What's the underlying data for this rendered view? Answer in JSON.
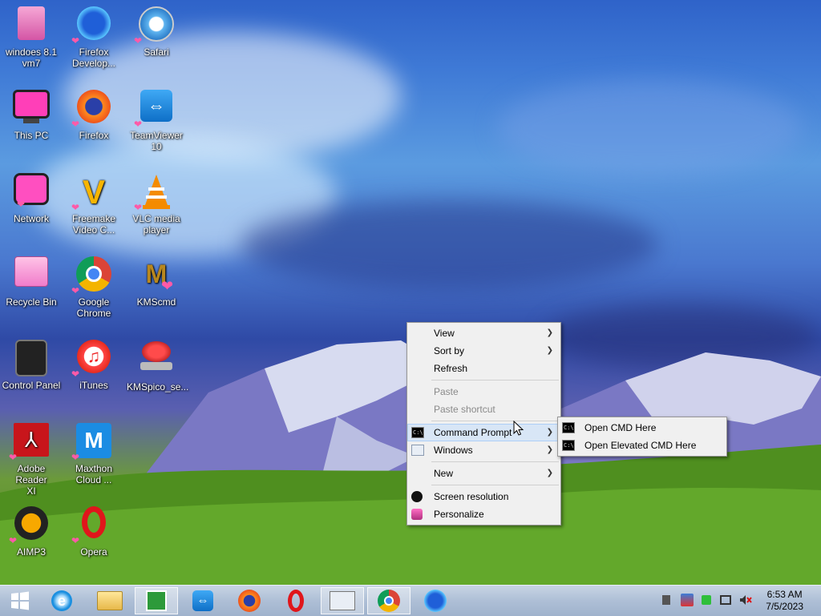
{
  "desktop_icons": [
    {
      "label": "windoes 8.1\nvm7",
      "icon": "user-folder-icon"
    },
    {
      "label": "Firefox\nDevelop...",
      "icon": "firefox-developer-icon"
    },
    {
      "label": "Safari",
      "icon": "safari-icon"
    },
    {
      "label": "This PC",
      "icon": "this-pc-icon"
    },
    {
      "label": "Firefox",
      "icon": "firefox-icon"
    },
    {
      "label": "TeamViewer\n10",
      "icon": "teamviewer-icon"
    },
    {
      "label": "Network",
      "icon": "network-icon"
    },
    {
      "label": "Freemake\nVideo C...",
      "icon": "freemake-icon"
    },
    {
      "label": "VLC media\nplayer",
      "icon": "vlc-icon"
    },
    {
      "label": "Recycle Bin",
      "icon": "recycle-bin-icon"
    },
    {
      "label": "Google\nChrome",
      "icon": "chrome-icon"
    },
    {
      "label": "KMScmd",
      "icon": "kmscmd-icon"
    },
    {
      "label": "Control Panel",
      "icon": "control-panel-icon"
    },
    {
      "label": "iTunes",
      "icon": "itunes-icon"
    },
    {
      "label": "KMSpico_se...",
      "icon": "kmspico-icon"
    },
    {
      "label": "Adobe Reader\nXI",
      "icon": "adobe-reader-icon"
    },
    {
      "label": "Maxthon\nCloud ...",
      "icon": "maxthon-icon"
    },
    {
      "label": "AIMP3",
      "icon": "aimp-icon"
    },
    {
      "label": "Opera",
      "icon": "opera-icon"
    }
  ],
  "context_menu": {
    "view": "View",
    "sort_by": "Sort by",
    "refresh": "Refresh",
    "paste": "Paste",
    "paste_shortcut": "Paste shortcut",
    "command_prompt": "Command Prompt",
    "windows": "Windows",
    "new": "New",
    "screen_resolution": "Screen resolution",
    "personalize": "Personalize"
  },
  "submenu": {
    "open_cmd": "Open CMD Here",
    "open_elevated_cmd": "Open Elevated CMD Here"
  },
  "taskbar": {
    "pinned": [
      "start-icon",
      "internet-explorer-icon",
      "file-explorer-icon",
      "store-icon",
      "teamviewer-icon",
      "firefox-icon",
      "opera-icon",
      "resource-monitor-icon",
      "chrome-icon",
      "firefox-developer-icon"
    ],
    "time": "6:53 AM",
    "date": "7/5/2023"
  },
  "colors": {
    "menu_bg": "#f0f0f0",
    "menu_highlight": "#d8e6f6",
    "taskbar": "#aebfd6"
  }
}
